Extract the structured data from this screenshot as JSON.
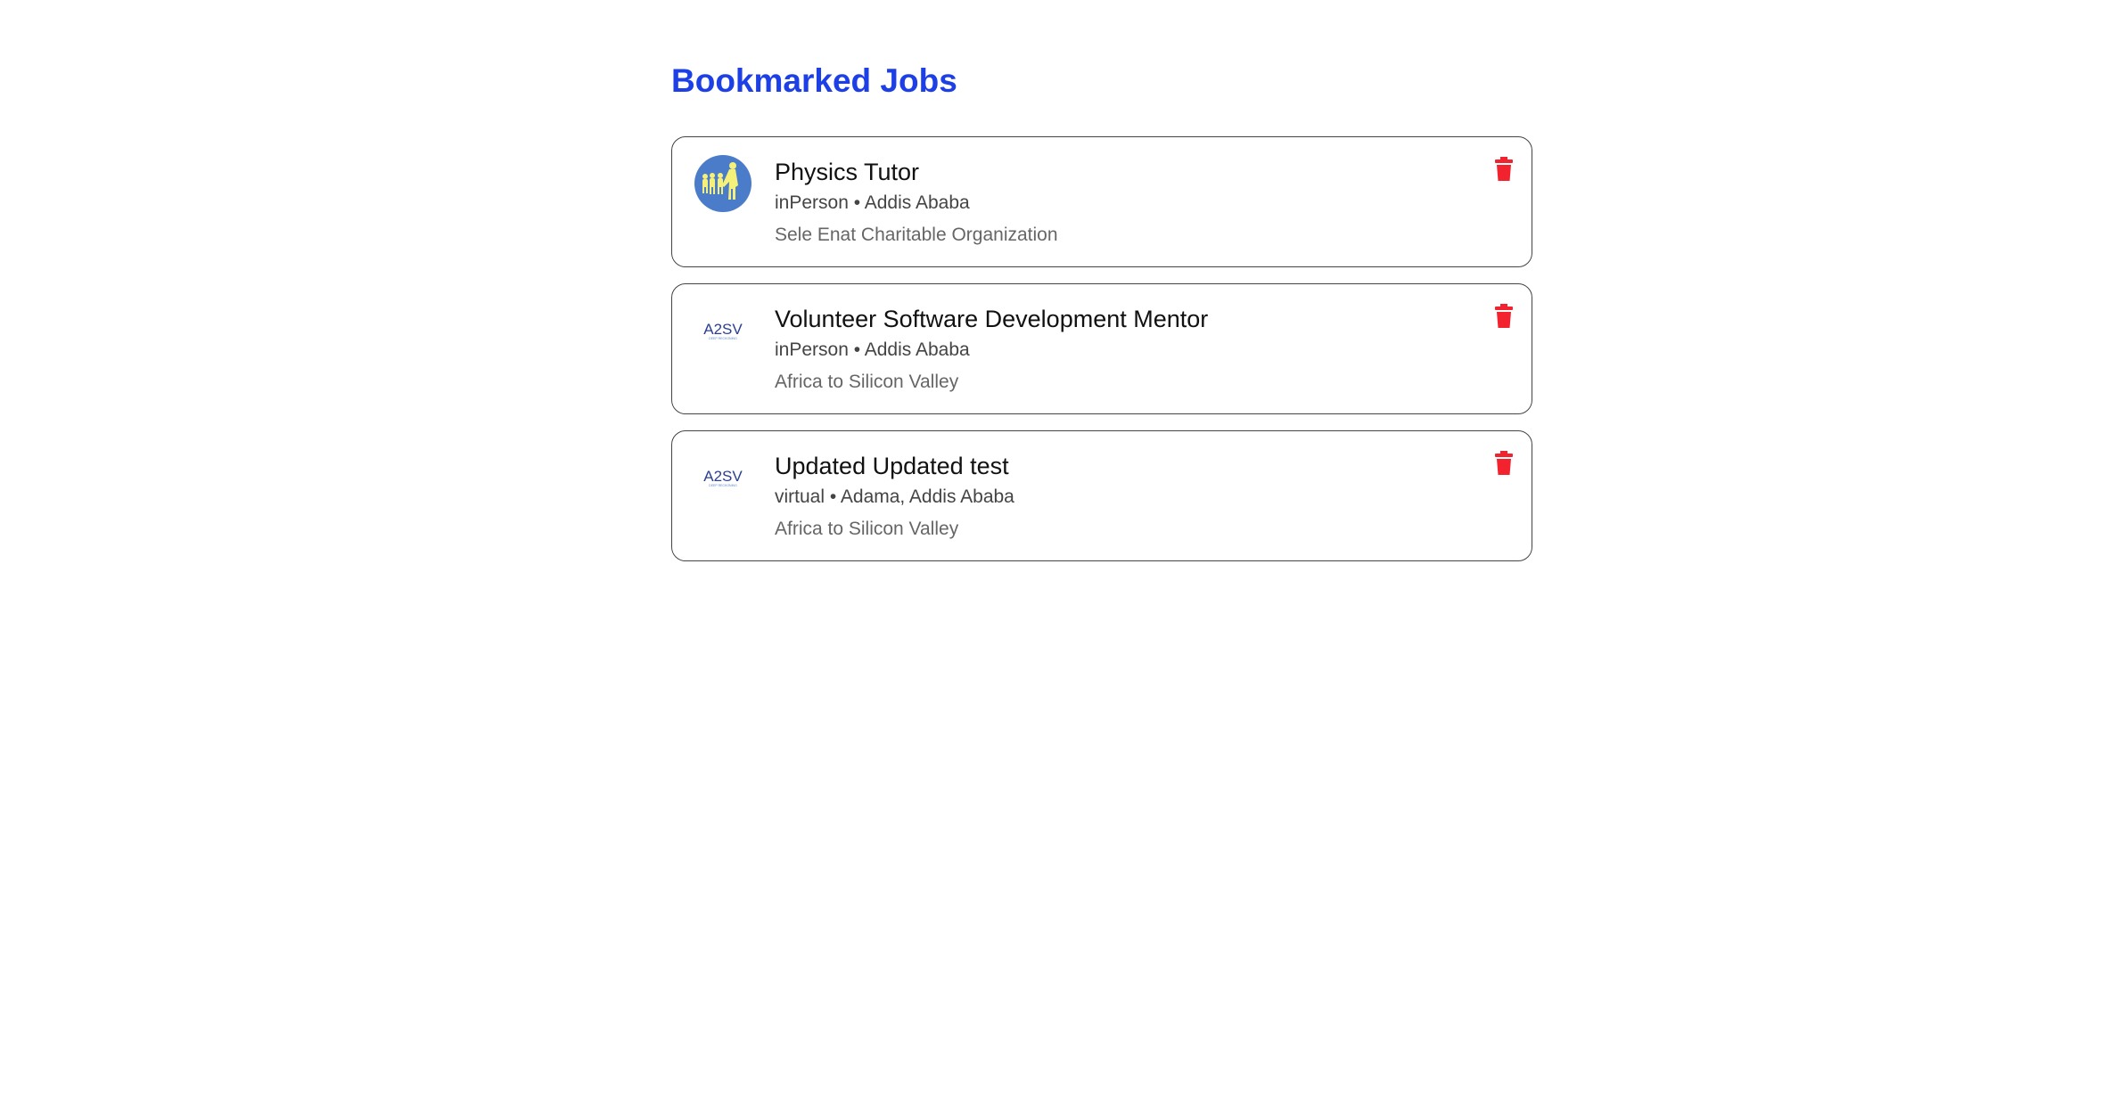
{
  "page": {
    "title": "Bookmarked Jobs"
  },
  "colors": {
    "accent": "#1d3fe6",
    "delete": "#f2232f"
  },
  "jobs": [
    {
      "title": "Physics Tutor",
      "meta": "inPerson • Addis Ababa",
      "organization": "Sele Enat Charitable Organization",
      "logo": "sele-enat-logo"
    },
    {
      "title": "Volunteer Software Development Mentor",
      "meta": "inPerson • Addis Ababa",
      "organization": "Africa to Silicon Valley",
      "logo": "a2sv-logo"
    },
    {
      "title": "Updated Updated test",
      "meta": "virtual • Adama, Addis Ababa",
      "organization": "Africa to Silicon Valley",
      "logo": "a2sv-logo"
    }
  ],
  "logos": {
    "a2sv_text": "A2SV",
    "a2sv_tagline": "DEEP RECKONING"
  }
}
